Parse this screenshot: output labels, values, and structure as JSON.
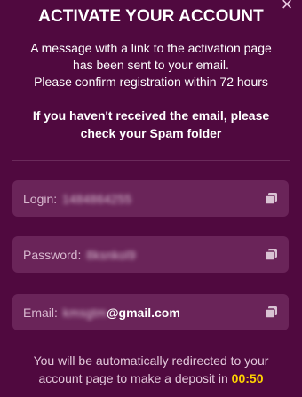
{
  "modal": {
    "close_icon": "close-icon",
    "title": "ACTIVATE YOUR ACCOUNT",
    "message_lines": [
      "A message with a link to the activation page",
      "has been sent to your email.",
      "Please confirm registration within 72 hours"
    ],
    "spam_notice_lines": [
      "If you haven't received the email, please",
      "check your Spam folder"
    ]
  },
  "fields": {
    "login": {
      "label": "Login:",
      "value": "1484864255",
      "copy_icon": "copy-icon"
    },
    "password": {
      "label": "Password:",
      "value": "8ksnkol9",
      "copy_icon": "copy-icon"
    },
    "email": {
      "label": "Email:",
      "value": "kmsgtm",
      "domain": "@gmail.com",
      "copy_icon": "copy-icon"
    }
  },
  "redirect": {
    "text_line1": "You will be automatically redirected to your",
    "text_line2": "account page to make a deposit in ",
    "countdown": "00:50"
  },
  "colors": {
    "background": "#50093f",
    "field_background": "#6a2459",
    "countdown": "#ffd400"
  }
}
